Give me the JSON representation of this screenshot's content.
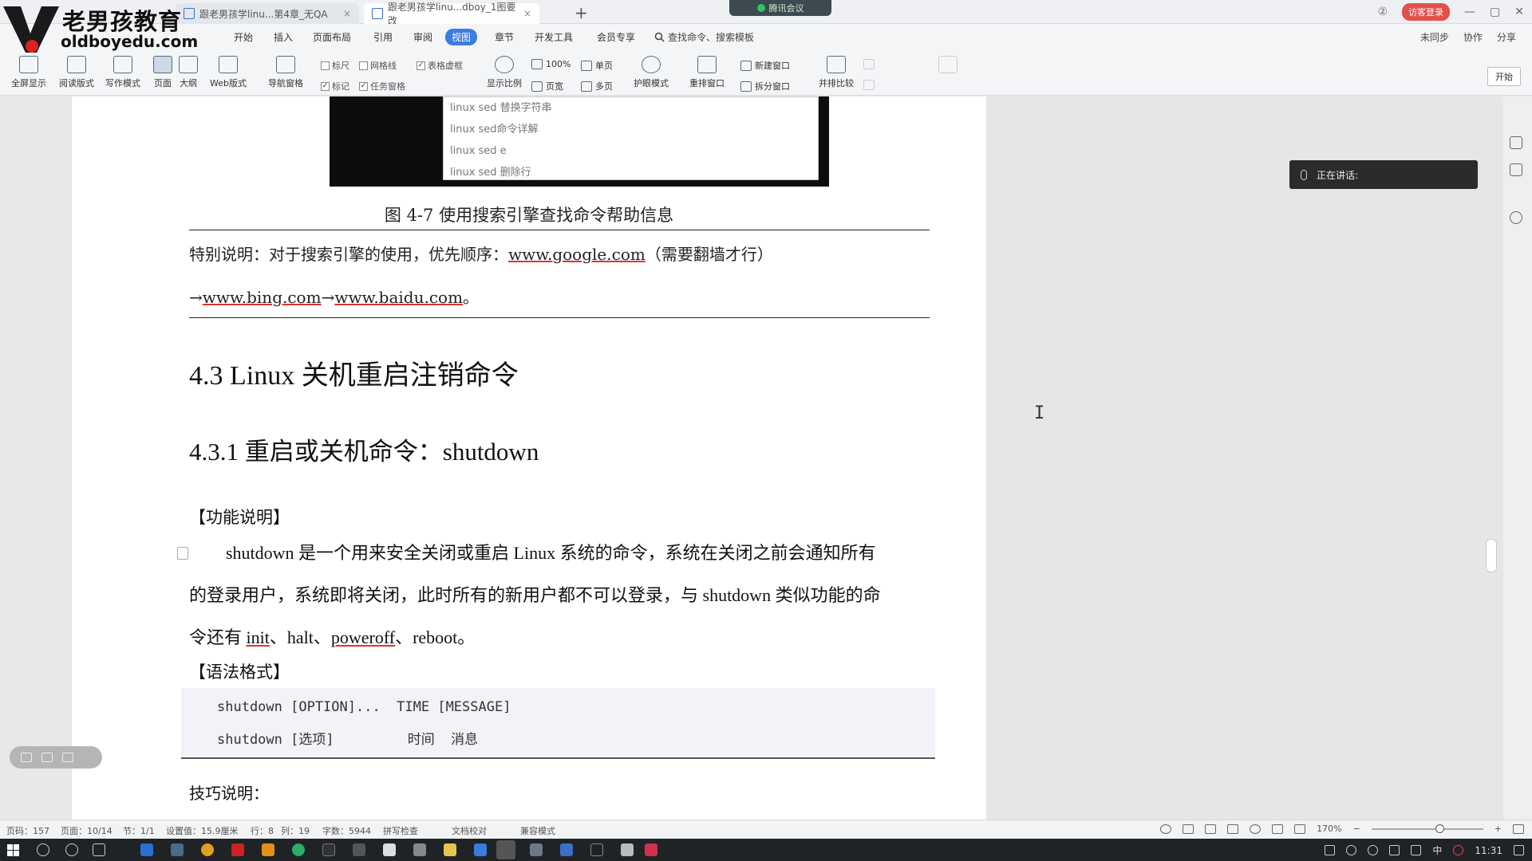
{
  "branding": {
    "logo_cn": "老男孩教育",
    "logo_en": "oldboyedu.com"
  },
  "tabs": [
    {
      "label": "跟老男孩学linu...第4章_无QA",
      "close": "×"
    },
    {
      "label": "跟老男孩学linu...dboy_1图要改",
      "close": "×"
    }
  ],
  "new_tab": "+",
  "meeting_status": "腾讯会议",
  "login_label": "访客登录",
  "window_controls": {
    "minimize": "—",
    "maximize": "▢",
    "close": "✕"
  },
  "menu": {
    "items": [
      "开始",
      "插入",
      "页面布局",
      "引用",
      "审阅",
      "视图",
      "章节",
      "开发工具",
      "会员专享"
    ],
    "active": "视图",
    "search_label": "查找命令、搜索模板",
    "right": [
      "未同步",
      "协作",
      "分享"
    ]
  },
  "ribbon": {
    "big": [
      {
        "label": "全屏显示"
      },
      {
        "label": "阅读版式"
      },
      {
        "label": "写作模式"
      },
      {
        "label": "页面"
      },
      {
        "label": "大纲"
      },
      {
        "label": "Web版式"
      },
      {
        "label": "导航窗格"
      }
    ],
    "checks": [
      {
        "label": "标尺",
        "checked": false
      },
      {
        "label": "网格线",
        "checked": false
      },
      {
        "label": "表格虚框",
        "checked": true
      },
      {
        "label": "标记",
        "checked": true
      },
      {
        "label": "任务窗格",
        "checked": true
      }
    ],
    "zoom_group": {
      "display_ratio": "显示比例",
      "percent": "100%",
      "single": "单页",
      "page_width": "页宽",
      "multi": "多页"
    },
    "eye_mode": "护眼模式",
    "rearrange": "重排窗口",
    "new_window": "新建窗口",
    "split_window": "拆分窗口",
    "side_by_side": "并排比较",
    "start_button": "开始"
  },
  "document": {
    "figure_popup": [
      "linux sed 替换字符串",
      "linux sed命令详解",
      "linux sed e",
      "linux sed 删除行"
    ],
    "caption": "图 4-7  使用搜索引擎查找命令帮助信息",
    "note_prefix": "特别说明：对于搜索引擎的使用，优先顺序：",
    "note_link1": "www.google.com",
    "note_suffix": "（需要翻墙才行）",
    "note_arrow1": "→",
    "note_link2": "www.bing.com",
    "note_arrow2": "→",
    "note_link3": "www.baidu.com",
    "note_end": "。",
    "heading2": "4.3 Linux 关机重启注销命令",
    "heading3": "4.3.1 重启或关机命令：shutdown",
    "func_label": "【功能说明】",
    "para1": "shutdown 是一个用来安全关闭或重启 Linux 系统的命令，系统在关闭之前会通知所有",
    "para2": "的登录用户，系统即将关闭，此时所有的新用户都不可以登录，与 shutdown 类似功能的命",
    "para3_prefix": "令还有 ",
    "para3_init": "init",
    "para3_sep1": "、halt、",
    "para3_poweroff": "poweroff",
    "para3_sep2": "、reboot。",
    "syntax_label": "【语法格式】",
    "code1": "shutdown [OPTION]...  TIME [MESSAGE]",
    "code2": "shutdown [选项]         时间  消息",
    "tips": "技巧说明："
  },
  "speaking_panel": "正在讲话:",
  "statusbar": {
    "page_no": "页码：157",
    "pages": "页面：10/14",
    "section": "节：1/1",
    "setting": "设置值：15.9厘米",
    "row": "行：8",
    "col": "列：19",
    "words": "字数：5944",
    "spell": "拼写检查",
    "proof": "文档校对",
    "compat": "兼容模式",
    "zoom": "170%",
    "zoom_minus": "−",
    "zoom_plus": "+"
  },
  "taskbar": {
    "time": "11:31",
    "ime": "中"
  }
}
